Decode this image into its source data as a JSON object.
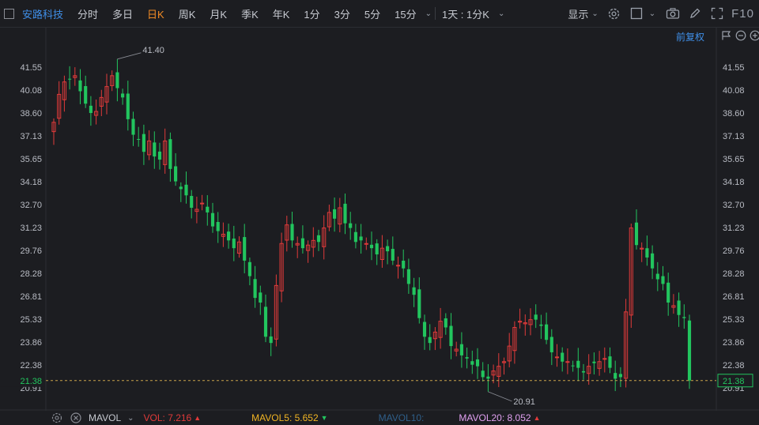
{
  "toolbar": {
    "stock_name": "安路科技",
    "tabs": [
      {
        "label": "分时",
        "active": false
      },
      {
        "label": "多日",
        "active": false
      },
      {
        "label": "日K",
        "active": true
      },
      {
        "label": "周K",
        "active": false
      },
      {
        "label": "月K",
        "active": false
      },
      {
        "label": "季K",
        "active": false
      },
      {
        "label": "年K",
        "active": false
      },
      {
        "label": "1分",
        "active": false
      },
      {
        "label": "3分",
        "active": false
      },
      {
        "label": "5分",
        "active": false
      },
      {
        "label": "15分",
        "active": false
      }
    ],
    "period_select": "1天 : 1分K",
    "display_label": "显示",
    "f10_label": "F10",
    "icons": [
      "settings-icon",
      "square-icon",
      "camera-icon",
      "pen-icon",
      "fullscreen-icon"
    ]
  },
  "adjust_label": "前复权",
  "colors": {
    "up": "#e03a3a",
    "down": "#22c55e",
    "bg": "#1c1d21",
    "accent": "#3f8fe8",
    "active": "#f08a24"
  },
  "chart_data": {
    "type": "candlestick",
    "y_ticks": [
      "41.55",
      "40.08",
      "38.60",
      "37.13",
      "35.65",
      "34.18",
      "32.70",
      "31.23",
      "29.76",
      "28.28",
      "26.81",
      "25.33",
      "23.86",
      "22.38",
      "20.91"
    ],
    "ylim": [
      20.91,
      41.55
    ],
    "current_price": "21.38",
    "high_annotation": "41.40",
    "low_annotation": "20.91",
    "closes": [
      38.0,
      39.8,
      40.6,
      40.8,
      41.0,
      40.0,
      39.2,
      38.6,
      38.7,
      39.6,
      40.3,
      41.0,
      40.2,
      39.6,
      38.2,
      37.2,
      36.9,
      36.1,
      36.8,
      35.8,
      35.6,
      36.8,
      35.0,
      34.2,
      33.7,
      33.3,
      32.5,
      32.4,
      32.8,
      32.2,
      31.3,
      31.0,
      30.8,
      30.4,
      29.9,
      30.3,
      29.1,
      28.1,
      26.7,
      26.4,
      24.2,
      23.8,
      27.5,
      30.2,
      31.4,
      30.4,
      30.2,
      29.9,
      30.1,
      30.4,
      30.3,
      31.2,
      32.2,
      31.8,
      32.5,
      31.5,
      31.2,
      30.3,
      30.4,
      30.2,
      29.9,
      29.5,
      29.9,
      29.7,
      29.1,
      28.8,
      28.6,
      27.6,
      26.9,
      25.4,
      24.2,
      23.8,
      24.5,
      25.2,
      24.8,
      23.6,
      23.4,
      23.0,
      22.8,
      22.4,
      22.3,
      21.6,
      21.5,
      22.0,
      22.3,
      22.6,
      23.6,
      24.8,
      25.2,
      25.1,
      25.3,
      25.3,
      24.9,
      24.0,
      23.2,
      22.9,
      22.6,
      22.6,
      22.3,
      22.2,
      21.9,
      22.3,
      22.5,
      22.6,
      22.8,
      22.2,
      21.5,
      21.6,
      25.8,
      31.2,
      30.1,
      29.9,
      29.3,
      28.6,
      27.9,
      27.6,
      26.4,
      26.2,
      25.6,
      25.4,
      21.38
    ],
    "volume_legend": {
      "name": "MAVOL",
      "items": [
        {
          "label": "VOL: 7.216",
          "arrow": "up",
          "color": "#e03a3a"
        },
        {
          "label": "MAVOL5: 5.652",
          "arrow": "down",
          "color": "#f0b423"
        },
        {
          "label": "MAVOL10:",
          "arrow": "",
          "color": "#2f5f8a"
        },
        {
          "label": "MAVOL20: 8.052",
          "arrow": "up",
          "color": "#e0a0f0"
        }
      ]
    }
  }
}
